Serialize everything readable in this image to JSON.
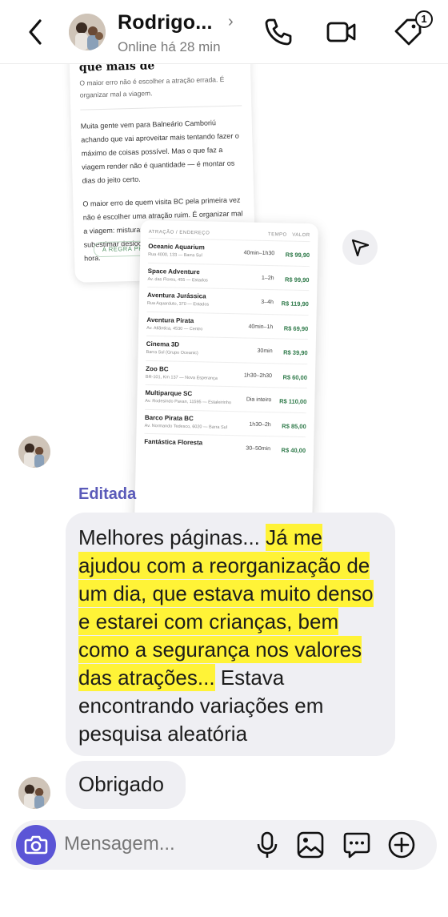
{
  "header": {
    "contact_name": "Rodrigo...",
    "status": "Online há 28 min",
    "badge_count": "1",
    "icons": [
      "back-chevron-icon",
      "phone-icon",
      "video-icon",
      "tag-icon"
    ]
  },
  "shared_image": {
    "heading_fragment": "que mais de",
    "subtitle": "O maior erro não é escolher a atração errada. É organizar mal a viagem.",
    "paragraph1": "Muita gente vem para Balneário Camboriú achando que vai aproveitar mais tentando fazer o máximo de coisas possível. Mas o que faz a viagem render não é quantidade — é montar os dias do jeito certo.",
    "paragraph2": "O maior erro de quem visita BC pela primeira vez não é escolher uma atração ruim. É organizar mal a viagem: misturar passeios que não combinam, subestimar desloc... no mesmo dia e c... a última hora.",
    "button_label": "A REGRA PRINC",
    "table_header": {
      "col1": "ATRAÇÃO / ENDEREÇO",
      "col2": "TEMPO",
      "col3": "VALOR"
    },
    "rows": [
      {
        "name": "Oceanic Aquarium",
        "address": "Rua 4000, 133 — Barra Sul",
        "duration": "40min–1h30",
        "price": "R$ 99,90"
      },
      {
        "name": "Space Adventure",
        "address": "Av. das Flores, 455 — Estados",
        "duration": "1–2h",
        "price": "R$ 99,90"
      },
      {
        "name": "Aventura Jurássica",
        "address": "Rua Aquarduto, 370 — Estados",
        "duration": "3–4h",
        "price": "R$ 119,90"
      },
      {
        "name": "Aventura Pirata",
        "address": "Av. Atlântica, 4530 — Centro",
        "duration": "40min–1h",
        "price": "R$ 69,90"
      },
      {
        "name": "Cinema 3D",
        "address": "Barra Sul (Grupo Oceanic)",
        "duration": "30min",
        "price": "R$ 39,90"
      },
      {
        "name": "Zoo BC",
        "address": "BR-101, Km 137 — Nova Esperança",
        "duration": "1h30–2h30",
        "price": "R$ 60,00"
      },
      {
        "name": "Multiparque SC",
        "address": "Av. Rodesindo Pavan, 11595 — Estaleirinho",
        "duration": "Dia inteiro",
        "price": "R$ 110,00"
      },
      {
        "name": "Barco Pirata BC",
        "address": "Av. Normando Tedesco, 6020 — Barra Sul",
        "duration": "1h30–2h",
        "price": "R$ 85,00"
      },
      {
        "name": "Fantástica Floresta",
        "address": "",
        "duration": "30–50min",
        "price": "R$ 40,00"
      }
    ]
  },
  "messages": {
    "edited_label": "Editada",
    "message1": {
      "part1": "Melhores páginas... ",
      "highlighted": "Já me ajudou com a reorganização de um dia, que estava muito denso e estarei com crianças, bem como a segurança nos valores das atrações...",
      "part2": " Estava encontrando variações em pesquisa aleatória"
    },
    "message2": "Obrigado",
    "highlight_color": "#fff337"
  },
  "composer": {
    "placeholder": "Mensagem...",
    "icons": [
      "camera-icon",
      "microphone-icon",
      "gallery-icon",
      "sticker-icon",
      "plus-icon"
    ],
    "accent_color": "#5b55d6"
  }
}
